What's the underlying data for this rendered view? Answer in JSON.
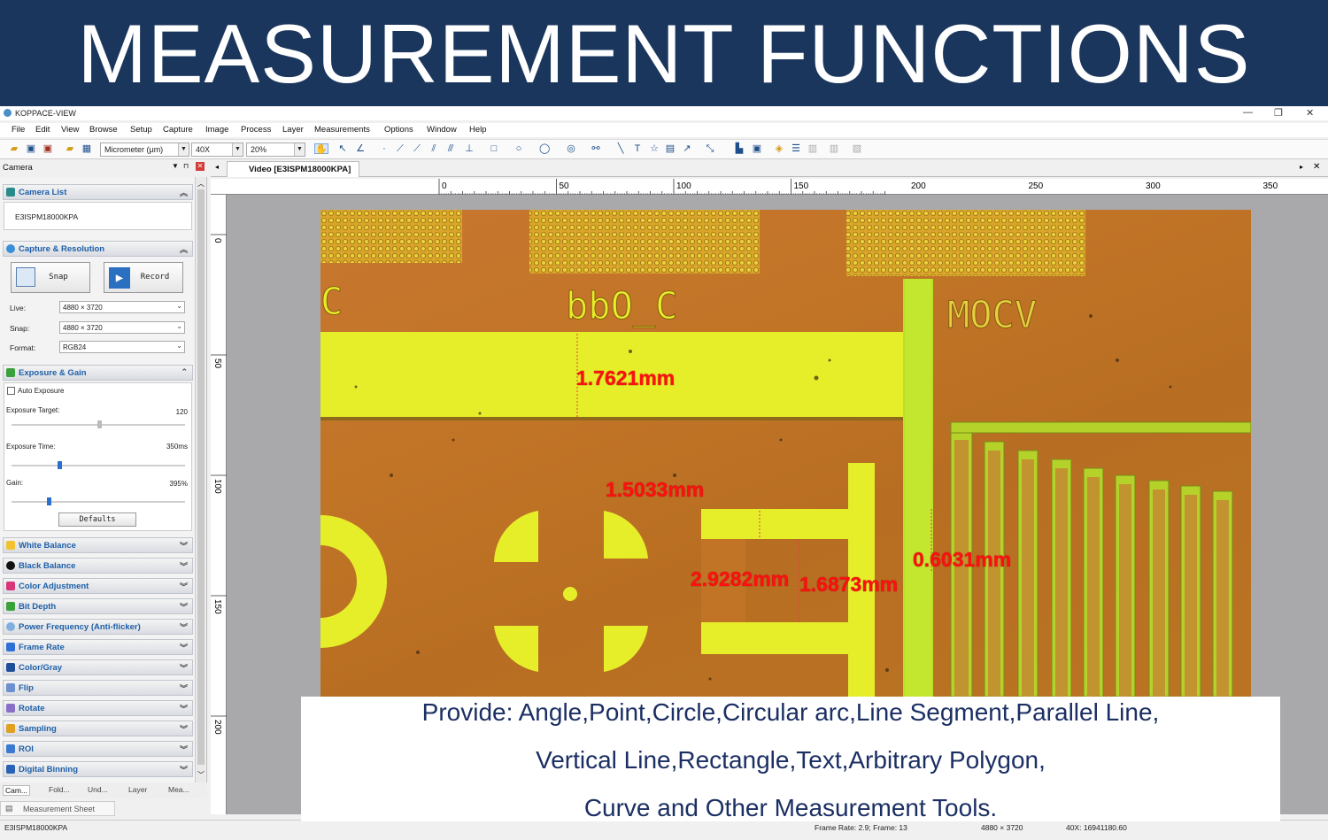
{
  "banner": {
    "title": "MEASUREMENT FUNCTIONS"
  },
  "window": {
    "title": "KOPPACE-VIEW",
    "minimize": "—",
    "maximize": "❐",
    "close": "✕"
  },
  "menu": [
    "File",
    "Edit",
    "View",
    "Browse",
    "Setup",
    "Capture",
    "Image",
    "Process",
    "Layer",
    "Measurements",
    "Options",
    "Window",
    "Help"
  ],
  "toolbar": {
    "unit": "Micrometer (µm)",
    "magnification": "40X",
    "zoom": "20%"
  },
  "left_panel": {
    "header": "Camera",
    "camera_list": {
      "label": "Camera List",
      "item": "E3ISPM18000KPA"
    },
    "capture": {
      "label": "Capture & Resolution",
      "snap": "Snap",
      "record": "Record",
      "live_label": "Live:",
      "live_value": "4880 × 3720",
      "snap_label": "Snap:",
      "snap_value": "4880 × 3720",
      "format_label": "Format:",
      "format_value": "RGB24"
    },
    "exposure": {
      "label": "Exposure & Gain",
      "auto": "Auto Exposure",
      "target_label": "Exposure Target:",
      "target_value": "120",
      "time_label": "Exposure Time:",
      "time_value": "350ms",
      "gain_label": "Gain:",
      "gain_value": "395%",
      "defaults": "Defaults"
    },
    "sections": [
      {
        "label": "White Balance",
        "color": "#f2c230"
      },
      {
        "label": "Black Balance",
        "color": "#111111"
      },
      {
        "label": "Color Adjustment",
        "color": "#d9367a"
      },
      {
        "label": "Bit Depth",
        "color": "#3aa23a"
      },
      {
        "label": "Power Frequency (Anti-flicker)",
        "color": "#7fb0e0"
      },
      {
        "label": "Frame Rate",
        "color": "#2f6fd6"
      },
      {
        "label": "Color/Gray",
        "color": "#1e4f9a"
      },
      {
        "label": "Flip",
        "color": "#6b8fd0"
      },
      {
        "label": "Rotate",
        "color": "#8a6fc8"
      },
      {
        "label": "Sampling",
        "color": "#e0a020"
      },
      {
        "label": "ROI",
        "color": "#3a7ad0"
      },
      {
        "label": "Digital Binning",
        "color": "#2a62b8"
      }
    ],
    "bottom_tabs": [
      "Cam...",
      "Fold...",
      "Und...",
      "Layer",
      "Mea..."
    ],
    "measurement_sheet": "Measurement Sheet"
  },
  "document": {
    "tab": "Video [E3ISPM18000KPA]",
    "ruler_h": [
      "0",
      "50",
      "100",
      "150",
      "200",
      "250",
      "300",
      "350"
    ],
    "ruler_v": [
      "0",
      "50",
      "100",
      "150",
      "200"
    ],
    "chip_labels": {
      "left": "bbO_C",
      "right": "MOCV",
      "edge": "C"
    },
    "measurements": [
      "1.7621mm",
      "1.5033mm",
      "2.9282mm",
      "1.6873mm",
      "0.6031mm"
    ]
  },
  "status": {
    "camera": "E3ISPM18000KPA",
    "frame": "Frame Rate: 2.9; Frame: 13",
    "resolution": "4880 × 3720",
    "coords": "40X: 16941180.60"
  },
  "caption": [
    "Provide: Angle,Point,Circle,Circular arc,Line Segment,Parallel Line,",
    "Vertical Line,Rectangle,Text,Arbitrary Polygon,",
    "Curve and Other Measurement Tools."
  ]
}
